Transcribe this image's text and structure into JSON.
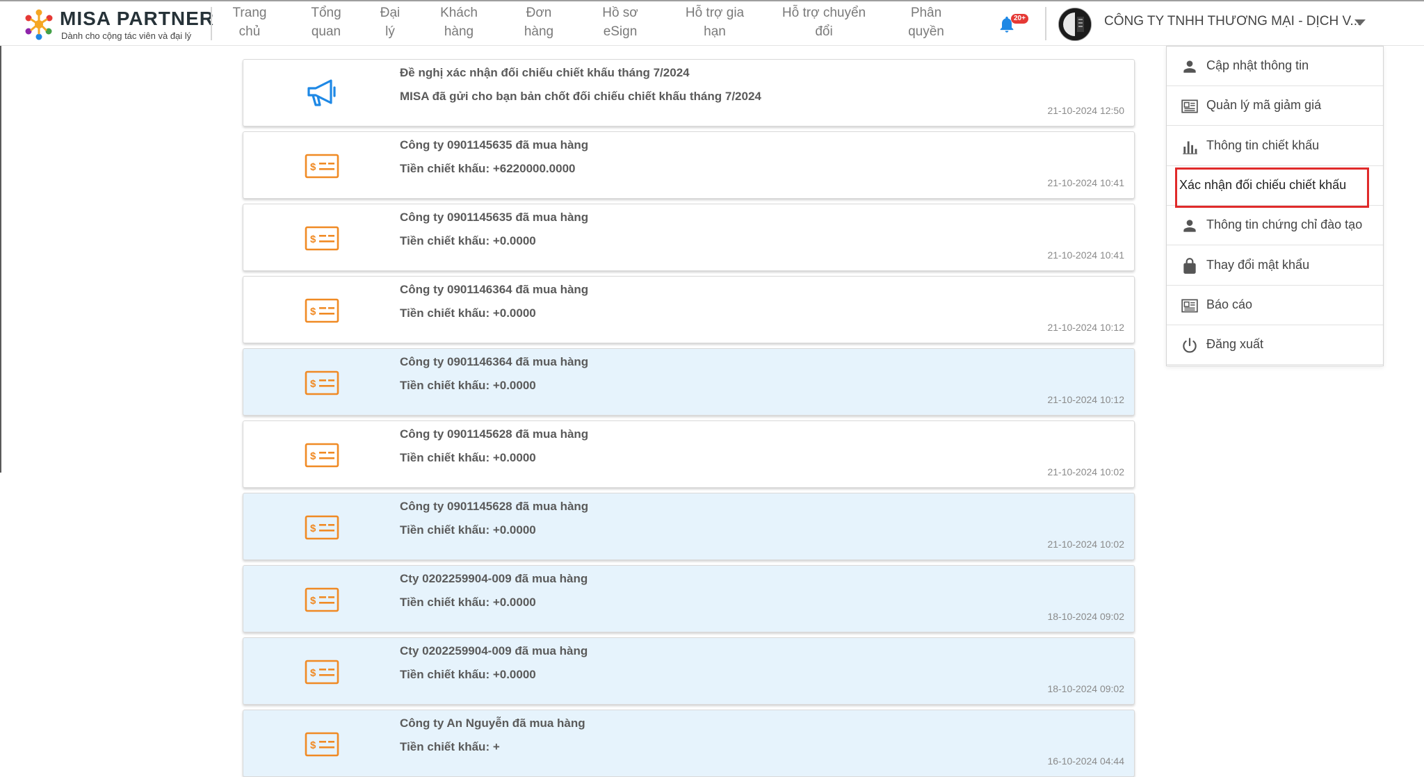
{
  "header": {
    "brand": "MISA PARTNER",
    "tagline": "Dành cho cộng tác viên và đại lý",
    "nav": [
      {
        "label": "Trang\nchủ"
      },
      {
        "label": "Tổng\nquan"
      },
      {
        "label": "Đại\nlý"
      },
      {
        "label": "Khách\nhàng"
      },
      {
        "label": "Đơn\nhàng"
      },
      {
        "label": "Hồ sơ\neSign"
      },
      {
        "label": "Hỗ trợ gia\nhạn"
      },
      {
        "label": "Hỗ trợ chuyển\nđổi"
      },
      {
        "label": "Phân\nquyền"
      }
    ],
    "notification_badge": "20+",
    "company": "CÔNG TY TNHH THƯƠNG MẠI - DỊCH V..."
  },
  "notifications": [
    {
      "icon": "megaphone-icon",
      "title": "Đề nghị xác nhận đối chiếu chiết khấu tháng 7/2024",
      "detail": "MISA đã gửi cho bạn bản chốt đối chiếu chiết khấu tháng 7/2024",
      "time": "21-10-2024 12:50",
      "unread": false
    },
    {
      "icon": "payment-card-icon",
      "title": "Công ty 0901145635 đã mua hàng",
      "detail": "Tiền chiết khấu: +6220000.0000",
      "time": "21-10-2024 10:41",
      "unread": false
    },
    {
      "icon": "payment-card-icon",
      "title": "Công ty 0901145635 đã mua hàng",
      "detail": "Tiền chiết khấu: +0.0000",
      "time": "21-10-2024 10:41",
      "unread": false
    },
    {
      "icon": "payment-card-icon",
      "title": "Công ty 0901146364 đã mua hàng",
      "detail": "Tiền chiết khấu: +0.0000",
      "time": "21-10-2024 10:12",
      "unread": false
    },
    {
      "icon": "payment-card-icon",
      "title": "Công ty 0901146364 đã mua hàng",
      "detail": "Tiền chiết khấu: +0.0000",
      "time": "21-10-2024 10:12",
      "unread": true
    },
    {
      "icon": "payment-card-icon",
      "title": "Công ty 0901145628 đã mua hàng",
      "detail": "Tiền chiết khấu: +0.0000",
      "time": "21-10-2024 10:02",
      "unread": false
    },
    {
      "icon": "payment-card-icon",
      "title": "Công ty 0901145628 đã mua hàng",
      "detail": "Tiền chiết khấu: +0.0000",
      "time": "21-10-2024 10:02",
      "unread": true
    },
    {
      "icon": "payment-card-icon",
      "title": "Cty 0202259904-009 đã mua hàng",
      "detail": "Tiền chiết khấu: +0.0000",
      "time": "18-10-2024 09:02",
      "unread": true
    },
    {
      "icon": "payment-card-icon",
      "title": "Cty 0202259904-009 đã mua hàng",
      "detail": "Tiền chiết khấu: +0.0000",
      "time": "18-10-2024 09:02",
      "unread": true
    },
    {
      "icon": "payment-card-icon",
      "title": "Công ty An Nguyễn đã mua hàng",
      "detail": "Tiền chiết khấu: +",
      "time": "16-10-2024 04:44",
      "unread": true
    }
  ],
  "user_menu": [
    {
      "label": "Cập nhật thông tin",
      "icon": "person-icon"
    },
    {
      "label": "Quản lý mã giảm giá",
      "icon": "newspaper-icon"
    },
    {
      "label": "Thông tin chiết khấu",
      "icon": "bar-chart-icon"
    },
    {
      "label": "Xác nhận đối chiếu chiết khấu",
      "icon": "",
      "highlighted": true
    },
    {
      "label": "Thông tin chứng chỉ đào tạo",
      "icon": "person-icon"
    },
    {
      "label": "Thay đổi mật khẩu",
      "icon": "lock-icon"
    },
    {
      "label": "Báo cáo",
      "icon": "newspaper-icon"
    },
    {
      "label": "Đăng xuất",
      "icon": "power-icon"
    }
  ],
  "colors": {
    "accent_blue": "#1e88e5",
    "card_icon_orange": "#f08a24",
    "unread_background": "#e6f3fc",
    "highlight_border": "#e02a2a"
  }
}
